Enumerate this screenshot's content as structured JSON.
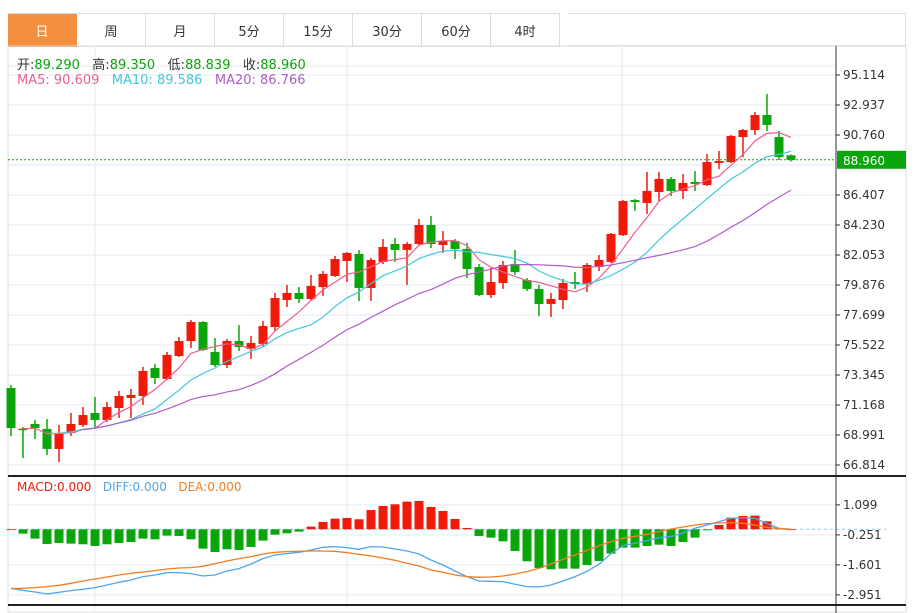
{
  "tabs": [
    {
      "label": "日",
      "active": true
    },
    {
      "label": "周"
    },
    {
      "label": "月"
    },
    {
      "label": "5分"
    },
    {
      "label": "15分"
    },
    {
      "label": "30分"
    },
    {
      "label": "60分"
    },
    {
      "label": "4时"
    }
  ],
  "ohlc_info": {
    "open_label": "开:",
    "open": "89.290",
    "high_label": "高:",
    "high": "89.350",
    "low_label": "低:",
    "low": "88.839",
    "close_label": "收:",
    "close": "88.960"
  },
  "ma_info": {
    "ma5": "MA5: 90.609",
    "ma10": "MA10: 89.586",
    "ma20": "MA20: 86.766"
  },
  "macd_info": {
    "macd": "MACD:0.000",
    "diff": "DIFF:0.000",
    "dea": "DEA:0.000"
  },
  "colors": {
    "up": "#f01a0a",
    "down": "#0aa50a",
    "ma5": "#ef5d8f",
    "ma10": "#40c8dc",
    "ma20": "#b05ccc",
    "diff": "#4ea6f0",
    "dea": "#f57c1f",
    "active_tab": "#f3903f"
  },
  "chart_data": [
    {
      "type": "candlestick",
      "price_axis_ticks": [
        "95.114",
        "92.937",
        "90.760",
        "86.407",
        "84.230",
        "82.053",
        "79.876",
        "77.699",
        "75.522",
        "73.345",
        "71.168",
        "68.991",
        "66.814"
      ],
      "ylim": [
        66.814,
        95.114
      ],
      "current_price": "88.960",
      "grid": true,
      "moving_averages": [
        5,
        10,
        20
      ],
      "candles_ohlc": [
        [
          72.4,
          72.62,
          68.92,
          69.5
        ],
        [
          69.45,
          69.57,
          67.32,
          69.43
        ],
        [
          69.79,
          70.08,
          68.7,
          69.5
        ],
        [
          69.43,
          70.15,
          67.54,
          67.98
        ],
        [
          67.98,
          69.72,
          67.03,
          69.14
        ],
        [
          69.14,
          70.59,
          68.92,
          69.79
        ],
        [
          69.72,
          71.02,
          69.57,
          70.44
        ],
        [
          70.59,
          71.75,
          69.5,
          70.08
        ],
        [
          70.08,
          71.39,
          69.94,
          71.02
        ],
        [
          70.95,
          72.19,
          70.23,
          71.82
        ],
        [
          71.68,
          72.33,
          70.23,
          71.9
        ],
        [
          71.82,
          73.93,
          71.17,
          73.64
        ],
        [
          73.85,
          74.14,
          72.69,
          73.13
        ],
        [
          73.06,
          75.02,
          72.98,
          74.8
        ],
        [
          74.72,
          76.1,
          74.65,
          75.81
        ],
        [
          75.81,
          77.34,
          75.31,
          77.19
        ],
        [
          77.19,
          77.26,
          75.09,
          75.16
        ],
        [
          75.02,
          76.03,
          73.93,
          74.07
        ],
        [
          74.07,
          75.96,
          73.85,
          75.81
        ],
        [
          75.81,
          76.97,
          75.09,
          75.38
        ],
        [
          75.23,
          76.17,
          74.51,
          75.67
        ],
        [
          75.6,
          77.26,
          75.45,
          76.9
        ],
        [
          76.83,
          79.3,
          76.54,
          78.93
        ],
        [
          78.79,
          79.88,
          78.28,
          79.3
        ],
        [
          79.3,
          79.73,
          78.57,
          78.86
        ],
        [
          78.86,
          80.6,
          78.79,
          79.81
        ],
        [
          79.73,
          80.89,
          79.08,
          80.68
        ],
        [
          80.53,
          81.98,
          80.46,
          81.76
        ],
        [
          81.62,
          82.27,
          80.09,
          82.2
        ],
        [
          82.13,
          82.42,
          78.71,
          79.66
        ],
        [
          79.66,
          81.84,
          78.72,
          81.69
        ],
        [
          81.55,
          83.21,
          81.4,
          82.63
        ],
        [
          82.85,
          83.29,
          81.55,
          82.42
        ],
        [
          82.42,
          83.0,
          79.88,
          82.85
        ],
        [
          82.85,
          84.67,
          82.71,
          84.23
        ],
        [
          84.23,
          84.88,
          82.56,
          82.85
        ],
        [
          82.78,
          83.79,
          82.2,
          83.07
        ],
        [
          83.07,
          83.21,
          81.76,
          82.49
        ],
        [
          82.49,
          82.92,
          80.38,
          81.04
        ],
        [
          81.18,
          81.4,
          79.08,
          79.15
        ],
        [
          79.15,
          81.11,
          78.93,
          80.09
        ],
        [
          80.02,
          81.62,
          79.59,
          81.33
        ],
        [
          81.4,
          82.42,
          80.6,
          80.82
        ],
        [
          80.24,
          80.38,
          79.44,
          79.59
        ],
        [
          79.59,
          79.88,
          77.63,
          78.5
        ],
        [
          78.5,
          79.3,
          77.55,
          78.86
        ],
        [
          78.79,
          80.31,
          78.13,
          80.02
        ],
        [
          80.09,
          80.82,
          79.59,
          79.95
        ],
        [
          79.95,
          81.47,
          79.37,
          81.33
        ],
        [
          81.18,
          82.05,
          80.89,
          81.69
        ],
        [
          81.55,
          83.65,
          81.47,
          83.58
        ],
        [
          83.5,
          86.04,
          83.43,
          85.97
        ],
        [
          86.04,
          86.12,
          85.25,
          85.9
        ],
        [
          85.83,
          88.08,
          85.03,
          86.7
        ],
        [
          86.62,
          88.08,
          85.97,
          87.57
        ],
        [
          87.57,
          87.71,
          86.33,
          86.7
        ],
        [
          86.7,
          87.93,
          86.12,
          87.28
        ],
        [
          87.35,
          88.15,
          86.7,
          87.21
        ],
        [
          87.13,
          89.38,
          87.06,
          88.8
        ],
        [
          88.73,
          89.6,
          88.29,
          88.87
        ],
        [
          88.8,
          90.76,
          88.73,
          90.69
        ],
        [
          90.61,
          91.2,
          89.16,
          91.12
        ],
        [
          91.12,
          92.43,
          90.76,
          92.21
        ],
        [
          92.21,
          93.74,
          91.05,
          91.49
        ],
        [
          90.61,
          91.05,
          88.95,
          89.16
        ],
        [
          89.29,
          89.35,
          88.839,
          88.96
        ]
      ]
    },
    {
      "type": "macd",
      "axis_ticks": [
        "1.099",
        "-0.251",
        "-1.601",
        "-2.951"
      ],
      "ylim": [
        -3.15,
        1.3
      ],
      "macd_histogram": [
        0,
        -0.195,
        -0.42,
        -0.66,
        -0.615,
        -0.645,
        -0.675,
        -0.75,
        -0.675,
        -0.615,
        -0.57,
        -0.42,
        -0.45,
        -0.285,
        -0.3,
        -0.45,
        -0.87,
        -1.02,
        -0.9,
        -0.93,
        -0.795,
        -0.51,
        -0.24,
        -0.18,
        -0.105,
        0.12,
        0.33,
        0.48,
        0.51,
        0.45,
        0.87,
        1.05,
        1.125,
        1.245,
        1.275,
        1.005,
        0.825,
        0.465,
        0.06,
        -0.3,
        -0.375,
        -0.54,
        -0.975,
        -1.44,
        -1.74,
        -1.8,
        -1.77,
        -1.77,
        -1.605,
        -1.425,
        -1.095,
        -0.825,
        -0.825,
        -0.75,
        -0.69,
        -0.75,
        -0.57,
        -0.375,
        -0.045,
        0.195,
        0.525,
        0.6,
        0.615,
        0.36,
        0.045,
        0
      ],
      "diff": [
        -2.655,
        -2.745,
        -2.82,
        -2.91,
        -2.835,
        -2.76,
        -2.7,
        -2.625,
        -2.505,
        -2.385,
        -2.28,
        -2.13,
        -2.055,
        -1.95,
        -1.95,
        -1.995,
        -2.1,
        -2.055,
        -1.875,
        -1.77,
        -1.56,
        -1.32,
        -1.155,
        -1.095,
        -1.035,
        -0.93,
        -0.81,
        -0.78,
        -0.825,
        -0.9,
        -0.78,
        -0.795,
        -0.885,
        -0.975,
        -1.11,
        -1.38,
        -1.605,
        -1.875,
        -2.13,
        -2.325,
        -2.34,
        -2.355,
        -2.475,
        -2.58,
        -2.595,
        -2.505,
        -2.325,
        -2.13,
        -1.89,
        -1.575,
        -1.095,
        -0.735,
        -0.63,
        -0.51,
        -0.375,
        -0.33,
        -0.165,
        0.045,
        0.195,
        0.345,
        0.495,
        0.525,
        0.495,
        0.255,
        0.045,
        0
      ],
      "dea": [
        -2.67,
        -2.655,
        -2.625,
        -2.58,
        -2.52,
        -2.43,
        -2.325,
        -2.235,
        -2.145,
        -2.055,
        -1.98,
        -1.92,
        -1.86,
        -1.785,
        -1.74,
        -1.725,
        -1.665,
        -1.545,
        -1.425,
        -1.32,
        -1.23,
        -1.11,
        -1.035,
        -1.005,
        -0.99,
        -0.975,
        -0.975,
        -0.99,
        -1.05,
        -1.125,
        -1.2,
        -1.29,
        -1.395,
        -1.53,
        -1.65,
        -1.83,
        -1.935,
        -2.055,
        -2.13,
        -2.16,
        -2.145,
        -2.1,
        -2.01,
        -1.905,
        -1.755,
        -1.56,
        -1.35,
        -1.155,
        -0.945,
        -0.735,
        -0.555,
        -0.405,
        -0.315,
        -0.225,
        -0.105,
        0.015,
        0.105,
        0.195,
        0.255,
        0.285,
        0.3,
        0.27,
        0.195,
        0.09,
        0.03,
        0
      ]
    }
  ]
}
